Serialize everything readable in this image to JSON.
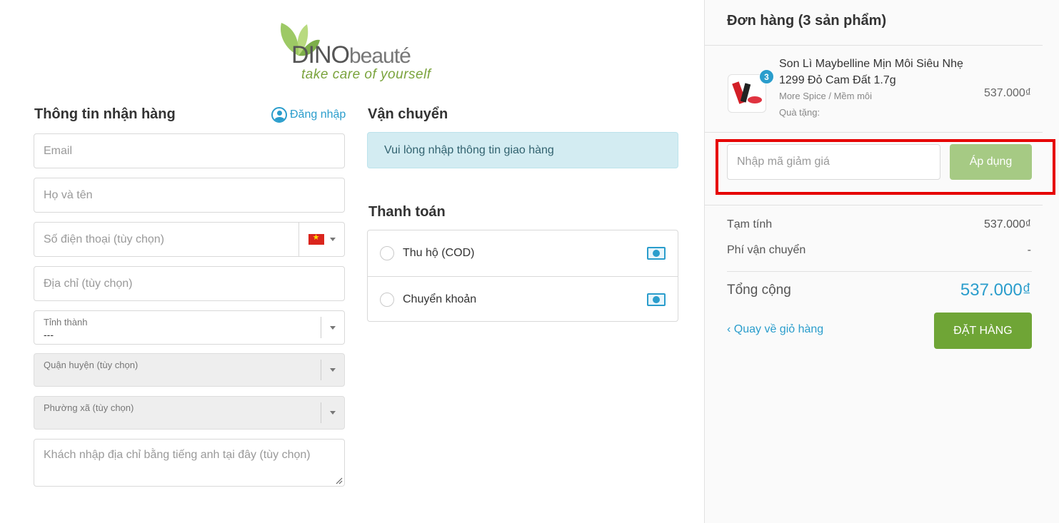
{
  "logo": {
    "brand_main": "DINO",
    "brand_sub": "beauté",
    "tagline": "take care of yourself"
  },
  "shipping_info_form": {
    "title": "Thông tin nhận hàng",
    "login_label": "Đăng nhập",
    "email_placeholder": "Email",
    "fullname_placeholder": "Họ và tên",
    "phone_placeholder": "Số điện thoại (tùy chọn)",
    "address_placeholder": "Địa chỉ (tùy chọn)",
    "province_label": "Tỉnh thành",
    "province_value": "---",
    "district_label": "Quận huyện (tùy chọn)",
    "ward_label": "Phường xã (tùy chọn)",
    "english_address_placeholder": "Khách nhập địa chỉ bằng tiếng anh tại đây (tùy chọn)"
  },
  "shipping": {
    "title": "Vận chuyển",
    "notice": "Vui lòng nhập thông tin giao hàng"
  },
  "payment": {
    "title": "Thanh toán",
    "options": [
      {
        "label": "Thu hộ (COD)",
        "icon": "cash-icon"
      },
      {
        "label": "Chuyển khoản",
        "icon": "cash-icon"
      }
    ]
  },
  "order": {
    "title": "Đơn hàng (3 sản phẩm)",
    "product": {
      "name": "Son Lì Maybelline Mịn Môi Siêu Nhẹ 1299 Đỏ Cam Đất 1.7g",
      "variant": "More Spice / Mềm môi",
      "gift": "Quà tặng:",
      "quantity": "3",
      "price": "537.000₫"
    },
    "coupon_placeholder": "Nhập mã giảm giá",
    "apply_label": "Áp dụng",
    "subtotal_label": "Tạm tính",
    "subtotal_value": "537.000₫",
    "shipping_fee_label": "Phí vận chuyển",
    "shipping_fee_value": "-",
    "total_label": "Tổng cộng",
    "total_value": "537.000₫",
    "back_label": "‹ Quay về giỏ hàng",
    "place_order_label": "ĐẶT HÀNG"
  },
  "colors": {
    "accent_blue": "#2a9dcc",
    "order_green": "#6fa536",
    "apply_green_disabled": "#a6ca84",
    "highlight_red": "#e60000"
  }
}
